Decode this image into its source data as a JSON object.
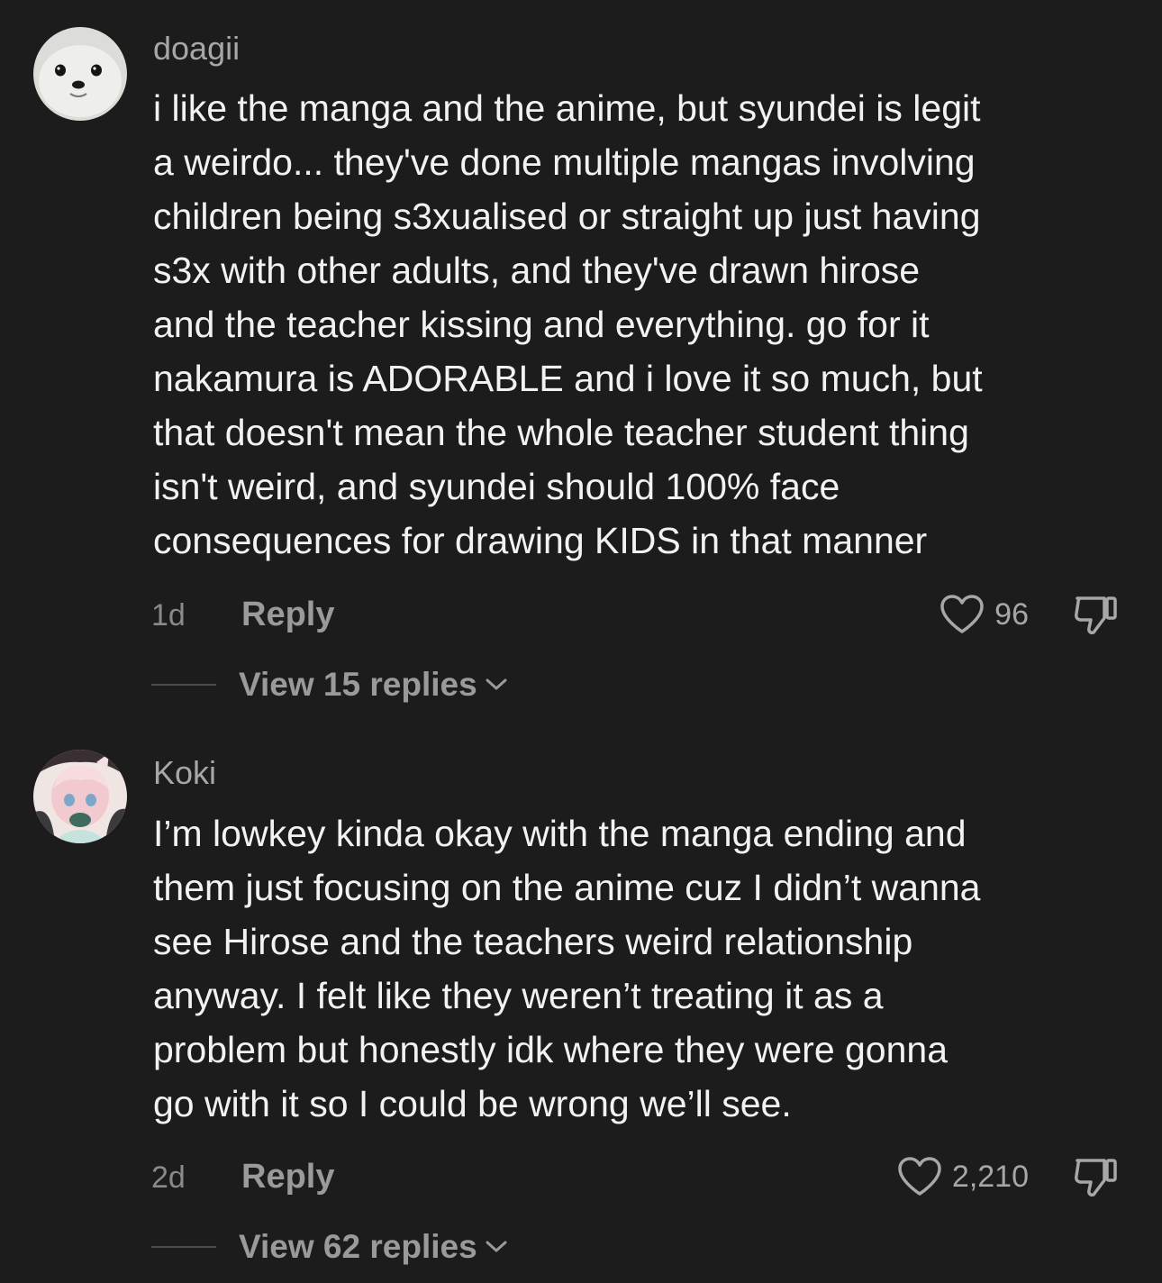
{
  "colors": {
    "background": "#1c1c1c",
    "username": "#a7a7a7",
    "body_text": "#f2f2f2",
    "muted": "#9a9a9a"
  },
  "comments": [
    {
      "username": "doagii",
      "avatar_icon": "seal-avatar",
      "lines": [
        "i like the manga and the anime, but syundei is legit",
        "a weirdo... they've done multiple mangas involving",
        "children being s3xualised or straight up just having",
        "s3x with other adults, and they've drawn hirose",
        "and the teacher kissing and everything. go for it",
        "nakamura is ADORABLE and i love it so much, but",
        "that doesn't mean the whole teacher student thing",
        "isn't weird, and syundei should 100% face",
        "consequences for drawing KIDS in that manner"
      ],
      "age": "1d",
      "reply_label": "Reply",
      "like_count": "96",
      "view_replies_label": "View 15 replies"
    },
    {
      "username": "Koki",
      "avatar_icon": "anime-character-avatar",
      "lines": [
        "I’m lowkey kinda okay with the manga ending and",
        "them just focusing on the anime cuz I didn’t wanna",
        "see Hirose and the teachers weird relationship",
        "anyway. I felt like they weren’t treating it as a",
        "problem but honestly idk where they were gonna",
        "go with it so I could be wrong we’ll see."
      ],
      "age": "2d",
      "reply_label": "Reply",
      "like_count": "2,210",
      "view_replies_label": "View 62 replies"
    }
  ]
}
